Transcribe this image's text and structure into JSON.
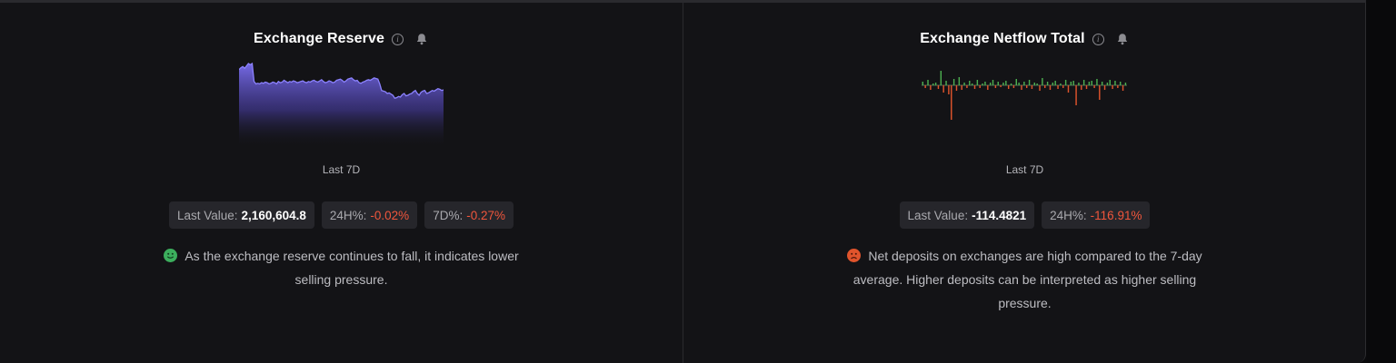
{
  "panels": {
    "reserve": {
      "title": "Exchange Reserve",
      "period": "Last 7D",
      "last_value_label": "Last Value:",
      "last_value": "2,160,604.8",
      "change_24h_label": "24H%:",
      "change_24h": "-0.02%",
      "change_7d_label": "7D%:",
      "change_7d": "-0.27%",
      "sentiment_icon": "happy-face-icon",
      "description_line1": "As the exchange reserve continues to fall, it indicates lower",
      "description_line2": "selling pressure."
    },
    "netflow": {
      "title": "Exchange Netflow Total",
      "period": "Last 7D",
      "last_value_label": "Last Value:",
      "last_value": "-114.4821",
      "change_24h_label": "24H%:",
      "change_24h": "-116.91%",
      "sentiment_icon": "sad-face-icon",
      "description_line1": "Net deposits on exchanges are high compared to the 7-day",
      "description_line2": "average. Higher deposits can be interpreted as higher selling",
      "description_line3": "pressure."
    }
  },
  "colors": {
    "accent_purple": "#7b6ff0",
    "negative": "#f0563c",
    "positive": "#3cae5d",
    "netflow_in": "#4caf50",
    "netflow_out": "#e0542c"
  },
  "chart_data": [
    {
      "type": "area",
      "series": [
        {
          "values": [
            0.9,
            0.93,
            0.95,
            0.92,
            0.96,
            1.0,
            0.98,
            1.0,
            0.7,
            0.66,
            0.67,
            0.66,
            0.68,
            0.67,
            0.69,
            0.68,
            0.66,
            0.67,
            0.69,
            0.68,
            0.66,
            0.7,
            0.68,
            0.69,
            0.72,
            0.7,
            0.68,
            0.7,
            0.69,
            0.71,
            0.7,
            0.68,
            0.69,
            0.7,
            0.71,
            0.69,
            0.68,
            0.7,
            0.69,
            0.71,
            0.72,
            0.7,
            0.69,
            0.71,
            0.73,
            0.7,
            0.68,
            0.69,
            0.71,
            0.7,
            0.68,
            0.69,
            0.72,
            0.73,
            0.74,
            0.72,
            0.69,
            0.71,
            0.74,
            0.75,
            0.76,
            0.73,
            0.71,
            0.72,
            0.68,
            0.67,
            0.69,
            0.7,
            0.72,
            0.73,
            0.72,
            0.74,
            0.76,
            0.75,
            0.74,
            0.66,
            0.55,
            0.54,
            0.53,
            0.5,
            0.51,
            0.49,
            0.47,
            0.42,
            0.43,
            0.45,
            0.44,
            0.48,
            0.5,
            0.46,
            0.47,
            0.49,
            0.5,
            0.53,
            0.55,
            0.5,
            0.47,
            0.52,
            0.54,
            0.55,
            0.5,
            0.51,
            0.53,
            0.55,
            0.54,
            0.56,
            0.58,
            0.57,
            0.55,
            0.56
          ]
        }
      ]
    },
    {
      "type": "bar",
      "series": [
        {
          "values": [
            0.4,
            -0.3,
            0.6,
            -0.5,
            0.2,
            0.3,
            -0.4,
            1.6,
            -0.8,
            0.5,
            -1.0,
            -3.8,
            0.7,
            -0.6,
            0.9,
            -0.5,
            0.3,
            -0.3,
            0.5,
            0.2,
            -0.4,
            0.6,
            -0.3,
            0.2,
            0.4,
            -0.5,
            0.3,
            0.6,
            -0.3,
            0.4,
            -0.2,
            0.3,
            0.5,
            -0.4,
            0.2,
            -0.3,
            0.7,
            0.3,
            -0.5,
            0.4,
            -0.3,
            0.6,
            -0.4,
            0.3,
            0.2,
            -0.6,
            0.8,
            -0.3,
            0.4,
            -0.5,
            0.3,
            0.5,
            -0.4,
            0.2,
            -0.3,
            0.6,
            -0.8,
            0.4,
            0.5,
            -2.2,
            0.3,
            -0.5,
            0.6,
            -0.4,
            0.4,
            0.5,
            -0.3,
            0.7,
            -1.6,
            0.4,
            -0.5,
            0.3,
            0.6,
            -0.4,
            0.5,
            -0.3,
            0.4,
            -0.6,
            0.3
          ]
        }
      ]
    }
  ]
}
